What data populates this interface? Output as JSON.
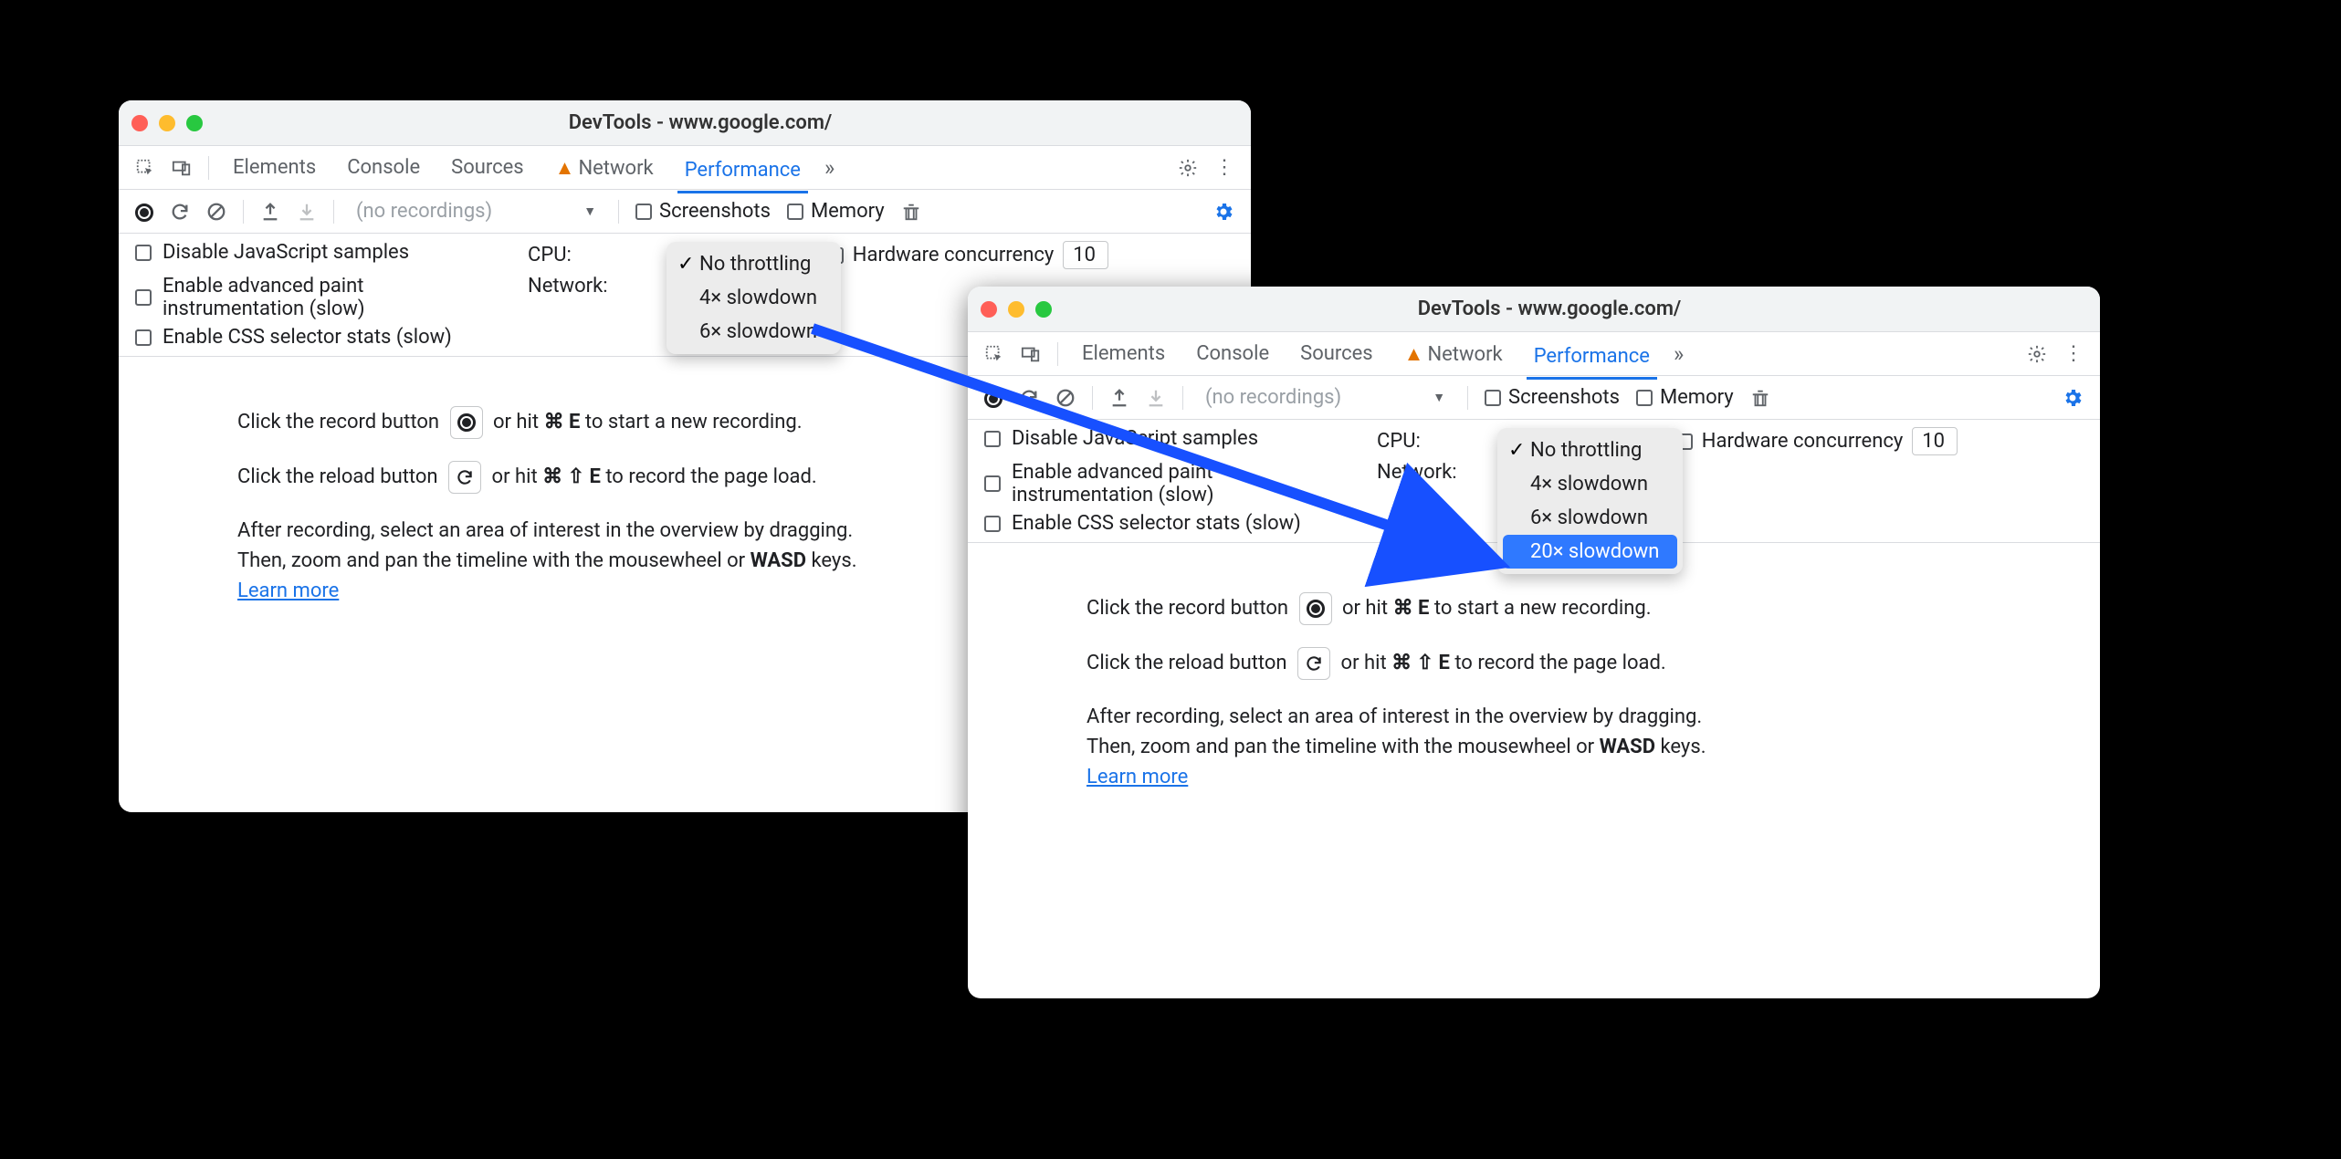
{
  "title": "DevTools - www.google.com/",
  "tabs": {
    "elements": "Elements",
    "console": "Console",
    "sources": "Sources",
    "network": "Network",
    "performance": "Performance"
  },
  "toolbar": {
    "no_recordings": "(no recordings)",
    "screenshots": "Screenshots",
    "memory": "Memory"
  },
  "settings": {
    "disable_js": "Disable JavaScript samples",
    "adv_paint": "Enable advanced paint instrumentation (slow)",
    "css_stats": "Enable CSS selector stats (slow)",
    "cpu_label": "CPU:",
    "network_label": "Network:",
    "hw_label": "Hardware concurrency",
    "hw_value": "10"
  },
  "dropdown1": {
    "no_throttle": "No throttling",
    "x4": "4× slowdown",
    "x6": "6× slowdown"
  },
  "dropdown2": {
    "no_throttle": "No throttling",
    "x4": "4× slowdown",
    "x6": "6× slowdown",
    "x20": "20× slowdown"
  },
  "body": {
    "rec1a": "Click the record button ",
    "rec1b": " or hit ",
    "rec1c": " to start a new recording.",
    "key_cmd": "⌘",
    "key_e": "E",
    "rel1a": "Click the reload button ",
    "rel1b": " or hit ",
    "rel1c": " to record the page load.",
    "key_shift": "⇧",
    "p1": "After recording, select an area of interest in the overview by dragging.",
    "p2a": "Then, zoom and pan the timeline with the mousewheel or ",
    "p2b": "WASD",
    "p2c": " keys.",
    "learn": "Learn more"
  }
}
